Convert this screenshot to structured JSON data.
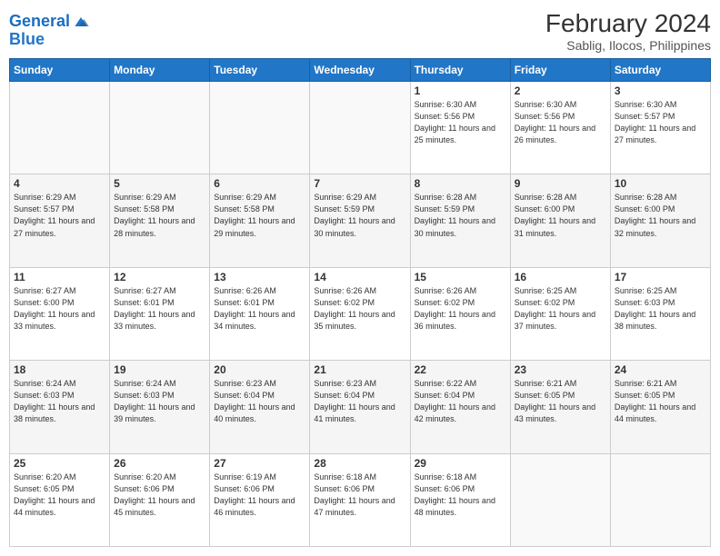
{
  "header": {
    "logo_line1": "General",
    "logo_line2": "Blue",
    "title": "February 2024",
    "subtitle": "Sablig, Ilocos, Philippines"
  },
  "days_of_week": [
    "Sunday",
    "Monday",
    "Tuesday",
    "Wednesday",
    "Thursday",
    "Friday",
    "Saturday"
  ],
  "weeks": [
    [
      {
        "day": "",
        "info": ""
      },
      {
        "day": "",
        "info": ""
      },
      {
        "day": "",
        "info": ""
      },
      {
        "day": "",
        "info": ""
      },
      {
        "day": "1",
        "info": "Sunrise: 6:30 AM\nSunset: 5:56 PM\nDaylight: 11 hours and 25 minutes."
      },
      {
        "day": "2",
        "info": "Sunrise: 6:30 AM\nSunset: 5:56 PM\nDaylight: 11 hours and 26 minutes."
      },
      {
        "day": "3",
        "info": "Sunrise: 6:30 AM\nSunset: 5:57 PM\nDaylight: 11 hours and 27 minutes."
      }
    ],
    [
      {
        "day": "4",
        "info": "Sunrise: 6:29 AM\nSunset: 5:57 PM\nDaylight: 11 hours and 27 minutes."
      },
      {
        "day": "5",
        "info": "Sunrise: 6:29 AM\nSunset: 5:58 PM\nDaylight: 11 hours and 28 minutes."
      },
      {
        "day": "6",
        "info": "Sunrise: 6:29 AM\nSunset: 5:58 PM\nDaylight: 11 hours and 29 minutes."
      },
      {
        "day": "7",
        "info": "Sunrise: 6:29 AM\nSunset: 5:59 PM\nDaylight: 11 hours and 30 minutes."
      },
      {
        "day": "8",
        "info": "Sunrise: 6:28 AM\nSunset: 5:59 PM\nDaylight: 11 hours and 30 minutes."
      },
      {
        "day": "9",
        "info": "Sunrise: 6:28 AM\nSunset: 6:00 PM\nDaylight: 11 hours and 31 minutes."
      },
      {
        "day": "10",
        "info": "Sunrise: 6:28 AM\nSunset: 6:00 PM\nDaylight: 11 hours and 32 minutes."
      }
    ],
    [
      {
        "day": "11",
        "info": "Sunrise: 6:27 AM\nSunset: 6:00 PM\nDaylight: 11 hours and 33 minutes."
      },
      {
        "day": "12",
        "info": "Sunrise: 6:27 AM\nSunset: 6:01 PM\nDaylight: 11 hours and 33 minutes."
      },
      {
        "day": "13",
        "info": "Sunrise: 6:26 AM\nSunset: 6:01 PM\nDaylight: 11 hours and 34 minutes."
      },
      {
        "day": "14",
        "info": "Sunrise: 6:26 AM\nSunset: 6:02 PM\nDaylight: 11 hours and 35 minutes."
      },
      {
        "day": "15",
        "info": "Sunrise: 6:26 AM\nSunset: 6:02 PM\nDaylight: 11 hours and 36 minutes."
      },
      {
        "day": "16",
        "info": "Sunrise: 6:25 AM\nSunset: 6:02 PM\nDaylight: 11 hours and 37 minutes."
      },
      {
        "day": "17",
        "info": "Sunrise: 6:25 AM\nSunset: 6:03 PM\nDaylight: 11 hours and 38 minutes."
      }
    ],
    [
      {
        "day": "18",
        "info": "Sunrise: 6:24 AM\nSunset: 6:03 PM\nDaylight: 11 hours and 38 minutes."
      },
      {
        "day": "19",
        "info": "Sunrise: 6:24 AM\nSunset: 6:03 PM\nDaylight: 11 hours and 39 minutes."
      },
      {
        "day": "20",
        "info": "Sunrise: 6:23 AM\nSunset: 6:04 PM\nDaylight: 11 hours and 40 minutes."
      },
      {
        "day": "21",
        "info": "Sunrise: 6:23 AM\nSunset: 6:04 PM\nDaylight: 11 hours and 41 minutes."
      },
      {
        "day": "22",
        "info": "Sunrise: 6:22 AM\nSunset: 6:04 PM\nDaylight: 11 hours and 42 minutes."
      },
      {
        "day": "23",
        "info": "Sunrise: 6:21 AM\nSunset: 6:05 PM\nDaylight: 11 hours and 43 minutes."
      },
      {
        "day": "24",
        "info": "Sunrise: 6:21 AM\nSunset: 6:05 PM\nDaylight: 11 hours and 44 minutes."
      }
    ],
    [
      {
        "day": "25",
        "info": "Sunrise: 6:20 AM\nSunset: 6:05 PM\nDaylight: 11 hours and 44 minutes."
      },
      {
        "day": "26",
        "info": "Sunrise: 6:20 AM\nSunset: 6:06 PM\nDaylight: 11 hours and 45 minutes."
      },
      {
        "day": "27",
        "info": "Sunrise: 6:19 AM\nSunset: 6:06 PM\nDaylight: 11 hours and 46 minutes."
      },
      {
        "day": "28",
        "info": "Sunrise: 6:18 AM\nSunset: 6:06 PM\nDaylight: 11 hours and 47 minutes."
      },
      {
        "day": "29",
        "info": "Sunrise: 6:18 AM\nSunset: 6:06 PM\nDaylight: 11 hours and 48 minutes."
      },
      {
        "day": "",
        "info": ""
      },
      {
        "day": "",
        "info": ""
      }
    ]
  ]
}
